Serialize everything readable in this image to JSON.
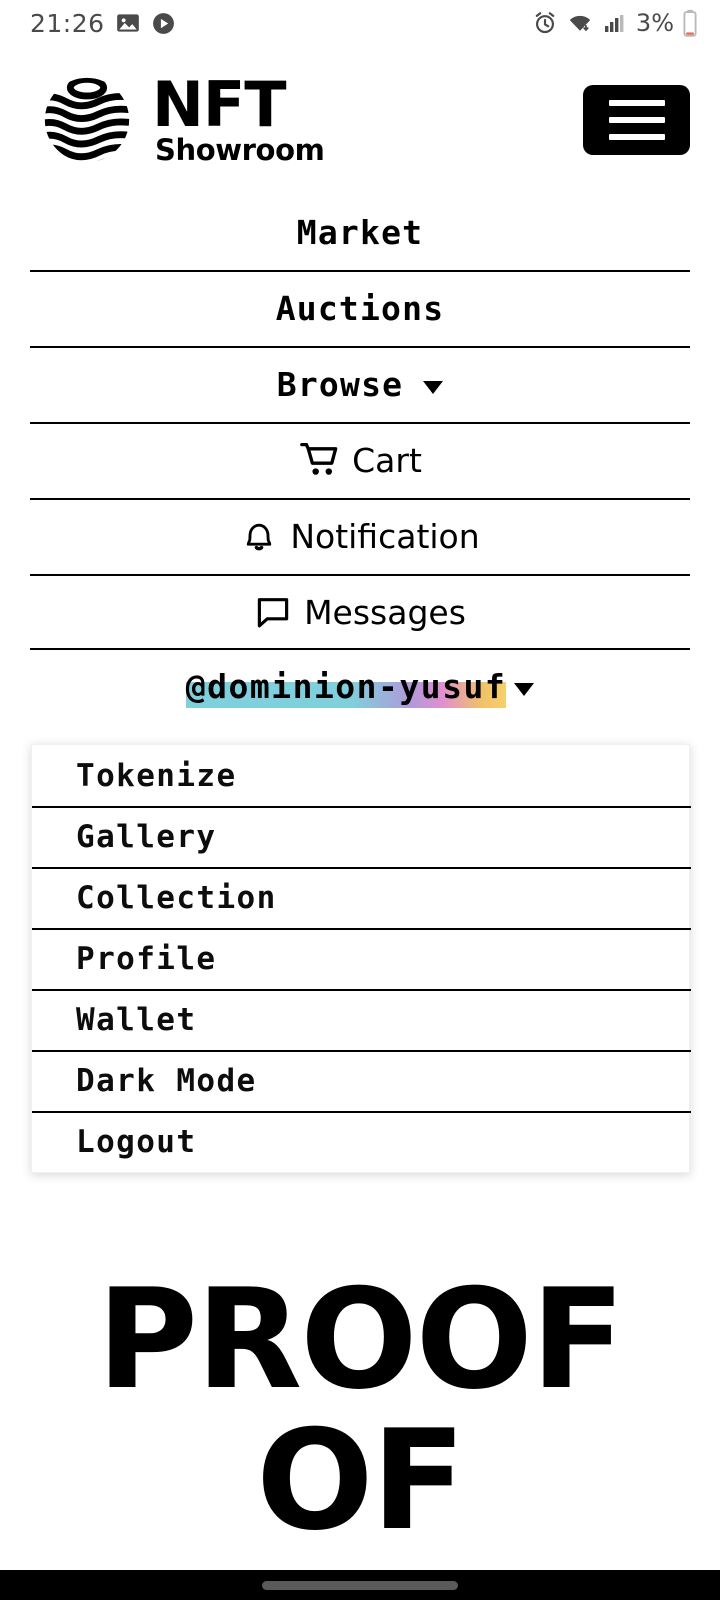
{
  "statusbar": {
    "time": "21:26",
    "left_icons": [
      "image-icon",
      "play-circle-icon"
    ],
    "right_icons": [
      "alarm-icon",
      "wifi-icon",
      "signal-icon"
    ],
    "battery_percent": "3%"
  },
  "header": {
    "logo_icon": "nft-showroom-sphere-logo",
    "brand_title": "NFT",
    "brand_subtitle": "Showroom",
    "menu_button_icon": "hamburger-menu-icon"
  },
  "nav": {
    "items": [
      {
        "label": "Market",
        "icon": null,
        "caret": false,
        "weight": "bold"
      },
      {
        "label": "Auctions",
        "icon": null,
        "caret": false,
        "weight": "bold"
      },
      {
        "label": "Browse",
        "icon": null,
        "caret": true,
        "weight": "bold"
      },
      {
        "label": "Cart",
        "icon": "shopping-cart-icon",
        "caret": false,
        "weight": "regular"
      },
      {
        "label": "Notification",
        "icon": "bell-icon",
        "caret": false,
        "weight": "regular"
      },
      {
        "label": "Messages",
        "icon": "message-bubble-icon",
        "caret": false,
        "weight": "regular"
      }
    ]
  },
  "user": {
    "username": "@dominion-yusuf",
    "caret_icon": "chevron-down-icon",
    "highlight_gradient": [
      "#7fcfdd",
      "#b09ad8",
      "#e08fd0",
      "#f7cf6b"
    ]
  },
  "dropdown": {
    "items": [
      {
        "label": "Tokenize"
      },
      {
        "label": "Gallery"
      },
      {
        "label": "Collection"
      },
      {
        "label": "Profile"
      },
      {
        "label": "Wallet"
      },
      {
        "label": "Dark Mode"
      },
      {
        "label": "Logout"
      }
    ]
  },
  "hero": {
    "lines": [
      "PROOF",
      "OF"
    ]
  },
  "sysnav": {
    "home_indicator": "home-indicator-pill"
  },
  "colors": {
    "background": "#ffffff",
    "text": "#000000",
    "divider": "#000000",
    "navbar": "#000000",
    "status_text": "#4a4a4a"
  }
}
